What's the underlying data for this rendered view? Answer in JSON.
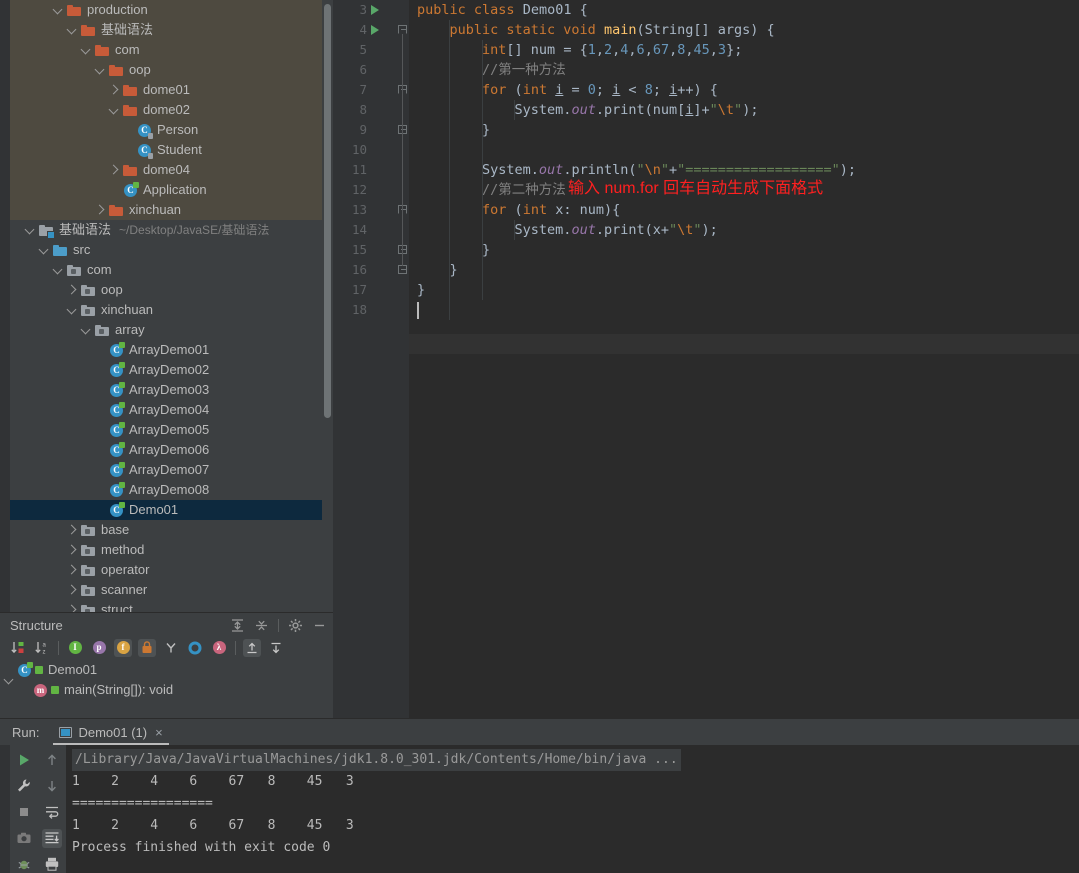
{
  "project_tree": {
    "rows": [
      {
        "indent": 3,
        "arrow": "down",
        "icon": "folder-orange",
        "label": "production",
        "bg": "production"
      },
      {
        "indent": 4,
        "arrow": "down",
        "icon": "folder-orange",
        "label": "基础语法",
        "bg": "production"
      },
      {
        "indent": 5,
        "arrow": "down",
        "icon": "folder-orange",
        "label": "com",
        "bg": "production"
      },
      {
        "indent": 6,
        "arrow": "down",
        "icon": "folder-orange",
        "label": "oop",
        "bg": "production"
      },
      {
        "indent": 7,
        "arrow": "right",
        "icon": "folder-orange",
        "label": "dome01",
        "bg": "production"
      },
      {
        "indent": 7,
        "arrow": "down",
        "icon": "folder-orange",
        "label": "dome02",
        "bg": "production"
      },
      {
        "indent": 8,
        "arrow": "none",
        "icon": "class-lock",
        "label": "Person",
        "bg": "production"
      },
      {
        "indent": 8,
        "arrow": "none",
        "icon": "class-lock",
        "label": "Student",
        "bg": "production"
      },
      {
        "indent": 7,
        "arrow": "right",
        "icon": "folder-orange",
        "label": "dome04",
        "bg": "production"
      },
      {
        "indent": 7,
        "arrow": "none",
        "icon": "class-run",
        "label": "Application",
        "bg": "production"
      },
      {
        "indent": 6,
        "arrow": "right",
        "icon": "folder-orange",
        "label": "xinchuan",
        "bg": "production"
      },
      {
        "indent": 1,
        "arrow": "down",
        "icon": "module",
        "label": "基础语法",
        "path": "~/Desktop/JavaSE/基础语法"
      },
      {
        "indent": 2,
        "arrow": "down",
        "icon": "folder-blue",
        "label": "src"
      },
      {
        "indent": 3,
        "arrow": "down",
        "icon": "folder-pkg",
        "label": "com"
      },
      {
        "indent": 4,
        "arrow": "right",
        "icon": "folder-pkg",
        "label": "oop"
      },
      {
        "indent": 4,
        "arrow": "down",
        "icon": "folder-pkg",
        "label": "xinchuan"
      },
      {
        "indent": 5,
        "arrow": "down",
        "icon": "folder-pkg",
        "label": "array"
      },
      {
        "indent": 6,
        "arrow": "none",
        "icon": "class-run",
        "label": "ArrayDemo01"
      },
      {
        "indent": 6,
        "arrow": "none",
        "icon": "class-run",
        "label": "ArrayDemo02"
      },
      {
        "indent": 6,
        "arrow": "none",
        "icon": "class-run",
        "label": "ArrayDemo03"
      },
      {
        "indent": 6,
        "arrow": "none",
        "icon": "class-run",
        "label": "ArrayDemo04"
      },
      {
        "indent": 6,
        "arrow": "none",
        "icon": "class-run",
        "label": "ArrayDemo05"
      },
      {
        "indent": 6,
        "arrow": "none",
        "icon": "class-run",
        "label": "ArrayDemo06"
      },
      {
        "indent": 6,
        "arrow": "none",
        "icon": "class-run",
        "label": "ArrayDemo07"
      },
      {
        "indent": 6,
        "arrow": "none",
        "icon": "class-run",
        "label": "ArrayDemo08"
      },
      {
        "indent": 6,
        "arrow": "none",
        "icon": "class-run",
        "label": "Demo01",
        "selected": true
      },
      {
        "indent": 4,
        "arrow": "right",
        "icon": "folder-pkg",
        "label": "base"
      },
      {
        "indent": 4,
        "arrow": "right",
        "icon": "folder-pkg",
        "label": "method"
      },
      {
        "indent": 4,
        "arrow": "right",
        "icon": "folder-pkg",
        "label": "operator"
      },
      {
        "indent": 4,
        "arrow": "right",
        "icon": "folder-pkg",
        "label": "scanner"
      },
      {
        "indent": 4,
        "arrow": "right",
        "icon": "folder-pkg",
        "label": "struct"
      }
    ]
  },
  "structure": {
    "title": "Structure",
    "header_icons": [
      "expand-all-icon",
      "collapse-all-icon",
      "settings-gear-icon",
      "hide-icon"
    ],
    "toolbar_buttons": [
      {
        "name": "sort-by-visibility-icon",
        "label": ""
      },
      {
        "name": "sort-alphabetically-icon",
        "label": ""
      },
      {
        "name": "show-inherited-icon",
        "label": "I",
        "color": "#62B543"
      },
      {
        "name": "show-properties-icon",
        "label": "p",
        "color": "#9876AA"
      },
      {
        "name": "show-fields-icon",
        "label": "f",
        "color": "#D9A343",
        "active": true
      },
      {
        "name": "show-non-public-icon",
        "label": "",
        "color": "#CC7832",
        "active": true
      },
      {
        "name": "show-anonymous-icon",
        "label": ""
      },
      {
        "name": "show-interfaces-icon",
        "label": "",
        "color": "#3592C4"
      },
      {
        "name": "show-lambdas-icon",
        "label": "λ",
        "color": "#C9657D"
      },
      {
        "name": "autoscroll-to-source-icon",
        "label": "",
        "active": true
      },
      {
        "name": "autoscroll-from-source-icon",
        "label": ""
      }
    ],
    "items": [
      {
        "indent": 0,
        "arrow": "down",
        "icon": "class-icon",
        "label": "Demo01"
      },
      {
        "indent": 1,
        "arrow": "none",
        "icon": "method-icon",
        "label": "main(String[]): void"
      }
    ]
  },
  "editor": {
    "lines": [
      {
        "num": "3",
        "run": true,
        "fold": "none",
        "indent": 0,
        "tokens": [
          {
            "t": "public ",
            "c": "kw"
          },
          {
            "t": "class ",
            "c": "kw"
          },
          {
            "t": "Demo01",
            "c": "txt"
          },
          {
            "t": " {",
            "c": "txt"
          }
        ]
      },
      {
        "num": "4",
        "run": true,
        "fold": "open",
        "indent": 1,
        "tokens": [
          {
            "t": "    ",
            "c": "txt"
          },
          {
            "t": "public static void ",
            "c": "kw"
          },
          {
            "t": "main",
            "c": "meth"
          },
          {
            "t": "(String[] args) {",
            "c": "txt"
          }
        ]
      },
      {
        "num": "5",
        "run": false,
        "fold": "none",
        "indent": 2,
        "tokens": [
          {
            "t": "        ",
            "c": "txt"
          },
          {
            "t": "int",
            "c": "kw"
          },
          {
            "t": "[] num = {",
            "c": "txt"
          },
          {
            "t": "1",
            "c": "num"
          },
          {
            "t": ",",
            "c": "txt"
          },
          {
            "t": "2",
            "c": "num"
          },
          {
            "t": ",",
            "c": "txt"
          },
          {
            "t": "4",
            "c": "num"
          },
          {
            "t": ",",
            "c": "txt"
          },
          {
            "t": "6",
            "c": "num"
          },
          {
            "t": ",",
            "c": "txt"
          },
          {
            "t": "67",
            "c": "num"
          },
          {
            "t": ",",
            "c": "txt"
          },
          {
            "t": "8",
            "c": "num"
          },
          {
            "t": ",",
            "c": "txt"
          },
          {
            "t": "45",
            "c": "num"
          },
          {
            "t": ",",
            "c": "txt"
          },
          {
            "t": "3",
            "c": "num"
          },
          {
            "t": "};",
            "c": "txt"
          }
        ]
      },
      {
        "num": "6",
        "run": false,
        "fold": "none",
        "indent": 2,
        "tokens": [
          {
            "t": "        ",
            "c": "txt"
          },
          {
            "t": "//第一种方法",
            "c": "cmt"
          }
        ]
      },
      {
        "num": "7",
        "run": false,
        "fold": "open",
        "indent": 2,
        "tokens": [
          {
            "t": "        ",
            "c": "txt"
          },
          {
            "t": "for",
            "c": "kw"
          },
          {
            "t": " (",
            "c": "txt"
          },
          {
            "t": "int",
            "c": "kw"
          },
          {
            "t": " ",
            "c": "txt"
          },
          {
            "t": "i",
            "c": "fld2"
          },
          {
            "t": " = ",
            "c": "txt"
          },
          {
            "t": "0",
            "c": "num"
          },
          {
            "t": "; ",
            "c": "txt"
          },
          {
            "t": "i",
            "c": "fld2"
          },
          {
            "t": " < ",
            "c": "txt"
          },
          {
            "t": "8",
            "c": "num"
          },
          {
            "t": "; ",
            "c": "txt"
          },
          {
            "t": "i",
            "c": "fld2"
          },
          {
            "t": "++) {",
            "c": "txt"
          }
        ]
      },
      {
        "num": "8",
        "run": false,
        "fold": "none",
        "indent": 3,
        "tokens": [
          {
            "t": "            System.",
            "c": "txt"
          },
          {
            "t": "out",
            "c": "stat"
          },
          {
            "t": ".print(num[",
            "c": "txt"
          },
          {
            "t": "i",
            "c": "fld2"
          },
          {
            "t": "]+",
            "c": "txt"
          },
          {
            "t": "\"",
            "c": "str"
          },
          {
            "t": "\\t",
            "c": "esc"
          },
          {
            "t": "\"",
            "c": "str"
          },
          {
            "t": ");",
            "c": "txt"
          }
        ]
      },
      {
        "num": "9",
        "run": false,
        "fold": "close",
        "indent": 2,
        "tokens": [
          {
            "t": "        }",
            "c": "txt"
          }
        ]
      },
      {
        "num": "10",
        "run": false,
        "fold": "none",
        "indent": 0,
        "tokens": []
      },
      {
        "num": "11",
        "run": false,
        "fold": "none",
        "indent": 2,
        "tokens": [
          {
            "t": "        System.",
            "c": "txt"
          },
          {
            "t": "out",
            "c": "stat"
          },
          {
            "t": ".println(",
            "c": "txt"
          },
          {
            "t": "\"",
            "c": "str"
          },
          {
            "t": "\\n",
            "c": "esc"
          },
          {
            "t": "\"",
            "c": "str"
          },
          {
            "t": "+",
            "c": "txt"
          },
          {
            "t": "\"==================\"",
            "c": "str"
          },
          {
            "t": ");",
            "c": "txt"
          }
        ]
      },
      {
        "num": "12",
        "run": false,
        "fold": "none",
        "indent": 2,
        "tokens": [
          {
            "t": "        ",
            "c": "txt"
          },
          {
            "t": "//第二种方法",
            "c": "cmt"
          }
        ],
        "annotation": "输入 num.for 回车自动生成下面格式"
      },
      {
        "num": "13",
        "run": false,
        "fold": "open",
        "indent": 2,
        "tokens": [
          {
            "t": "        ",
            "c": "txt"
          },
          {
            "t": "for",
            "c": "kw"
          },
          {
            "t": " (",
            "c": "txt"
          },
          {
            "t": "int",
            "c": "kw"
          },
          {
            "t": " x: num){",
            "c": "txt"
          }
        ]
      },
      {
        "num": "14",
        "run": false,
        "fold": "none",
        "indent": 3,
        "tokens": [
          {
            "t": "            System.",
            "c": "txt"
          },
          {
            "t": "out",
            "c": "stat"
          },
          {
            "t": ".print(x+",
            "c": "txt"
          },
          {
            "t": "\"",
            "c": "str"
          },
          {
            "t": "\\t",
            "c": "esc"
          },
          {
            "t": "\"",
            "c": "str"
          },
          {
            "t": ");",
            "c": "txt"
          }
        ]
      },
      {
        "num": "15",
        "run": false,
        "fold": "close",
        "indent": 2,
        "tokens": [
          {
            "t": "        }",
            "c": "txt"
          }
        ]
      },
      {
        "num": "16",
        "run": false,
        "fold": "close",
        "indent": 1,
        "tokens": [
          {
            "t": "    }",
            "c": "txt"
          }
        ]
      },
      {
        "num": "17",
        "run": false,
        "fold": "none",
        "indent": 0,
        "tokens": [
          {
            "t": "}",
            "c": "txt"
          }
        ]
      },
      {
        "num": "18",
        "run": false,
        "fold": "none",
        "indent": 0,
        "tokens": [],
        "caret": true,
        "highlight": true
      }
    ]
  },
  "run_panel": {
    "label": "Run:",
    "tab_name": "Demo01 (1)",
    "close_glyph": "×",
    "toolbar_left": [
      "run-icon",
      "settings-wrench-icon",
      "stop-icon",
      "screenshot-camera-icon",
      "debug-bug-icon"
    ],
    "toolbar_right": [
      "up-arrow-icon",
      "down-arrow-icon",
      "soft-wrap-icon",
      "scroll-to-end-icon",
      "print-icon"
    ],
    "console_lines": [
      {
        "text": "/Library/Java/JavaVirtualMachines/jdk1.8.0_301.jdk/Contents/Home/bin/java ...",
        "style": "cmd"
      },
      {
        "text": "1    2    4    6    67   8    45   3",
        "style": "out"
      },
      {
        "text": "==================",
        "style": "out"
      },
      {
        "text": "1    2    4    6    67   8    45   3",
        "style": "out"
      },
      {
        "text": "Process finished with exit code 0",
        "style": "out"
      }
    ]
  },
  "colors": {
    "editor_bg": "#2B2B2B",
    "panel_bg": "#3C3F41",
    "gutter_bg": "#313335",
    "production_bg": "#4E4A40",
    "selection_bg": "#0D293E",
    "accent_orange": "#CC7832",
    "accent_green": "#59A869",
    "annotation_red": "#FF2020"
  }
}
